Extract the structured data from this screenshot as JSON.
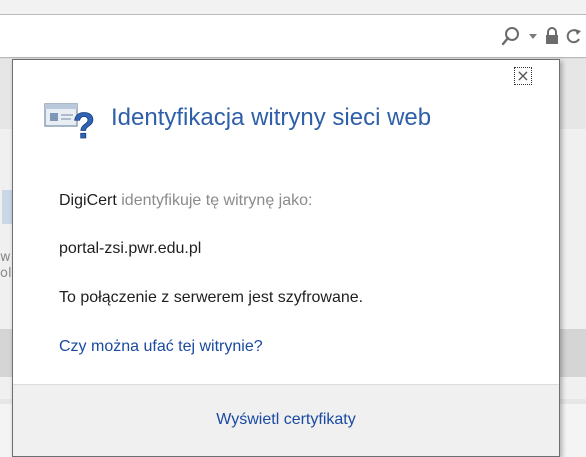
{
  "browser": {
    "address_icons": [
      {
        "name": "search-icon"
      },
      {
        "name": "dropdown-arrow-icon"
      },
      {
        "name": "lock-icon"
      },
      {
        "name": "refresh-icon"
      }
    ]
  },
  "background_fragments": {
    "left_edge": [
      "w",
      "ol"
    ]
  },
  "popup": {
    "title": "Identyfikacja witryny sieci web",
    "issuer": "DigiCert",
    "identifies_text": "identyfikuje tę witrynę jako:",
    "site": "portal-zsi.pwr.edu.pl",
    "encryption_text": "To połączenie z serwerem jest szyfrowane.",
    "trust_link": "Czy można ufać tej witrynie?",
    "view_certificates": "Wyświetl certyfikaty",
    "close_glyph": "×"
  },
  "colors": {
    "title_blue": "#2e5fa8",
    "link_blue": "#1a4aa1",
    "muted_gray": "#8b8b8b"
  }
}
